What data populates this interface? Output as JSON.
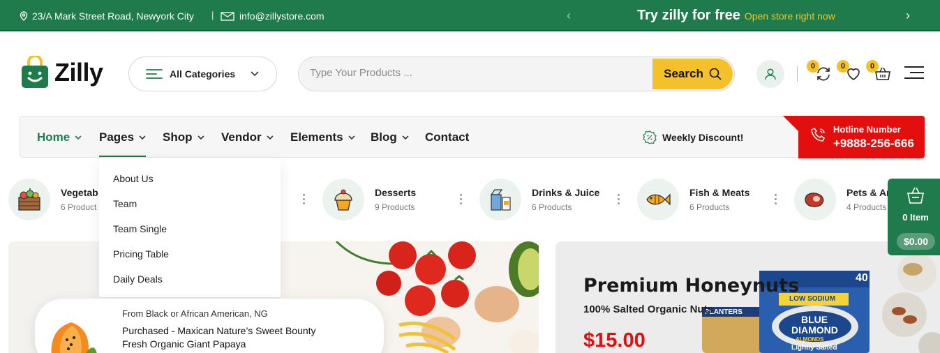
{
  "topbar": {
    "address": "23/A Mark Street Road, Newyork City",
    "separator": "|",
    "email": "info@zillystore.com",
    "promo_main": "Try zilly for free",
    "promo_link": "Open store right now"
  },
  "brand": {
    "name": "Zilly"
  },
  "header": {
    "categories_label": "All Categories",
    "search_placeholder": "Type Your Products ...",
    "search_button": "Search",
    "compare_count": "0",
    "wishlist_count": "0",
    "cart_count": "0"
  },
  "nav": {
    "items": [
      "Home",
      "Pages",
      "Shop",
      "Vendor",
      "Elements",
      "Blog",
      "Contact"
    ],
    "weekly_discount": "Weekly Discount!",
    "hotline_label": "Hotline Number",
    "hotline_number": "+9888-256-666"
  },
  "dropdown": {
    "items": [
      "About Us",
      "Team",
      "Team Single",
      "Pricing Table",
      "Daily Deals"
    ]
  },
  "categories": [
    {
      "name": "Vegetab",
      "count": "6 Product"
    },
    {
      "name": "Desserts",
      "count": "9 Products"
    },
    {
      "name": "Drinks & Juice",
      "count": "6 Products"
    },
    {
      "name": "Fish & Meats",
      "count": "6 Products"
    },
    {
      "name": "Pets & An",
      "count": "4 Products"
    }
  ],
  "banner2": {
    "title": "Premium Honeynuts",
    "subtitle": "100% Salted Organic Nuts",
    "price": "$15.00",
    "package_text": [
      "40",
      "LOW SODIUM",
      "BLUE",
      "DIAMOND",
      "ALMONDS",
      "Lightly Salted",
      "PLANTERS"
    ]
  },
  "popup": {
    "from": "From Black or African American, NG",
    "line1": "Purchased - Maxican Nature’s Sweet Bounty",
    "line2": "Fresh Organic Giant Papaya"
  },
  "cart_widget": {
    "items": "0 Item",
    "total": "$0.00"
  },
  "colors": {
    "primary": "#1f7a4c",
    "accent": "#f5c12b",
    "hotline": "#e30e0e"
  },
  "icons": [
    "location-icon",
    "mail-icon",
    "chevron-left-icon",
    "chevron-right-icon",
    "shopping-bag-logo-icon",
    "filter-lines-icon",
    "chevron-down-icon",
    "search-icon",
    "user-icon",
    "refresh-icon",
    "heart-icon",
    "basket-icon",
    "hamburger-icon",
    "percent-badge-icon",
    "phone-icon"
  ]
}
